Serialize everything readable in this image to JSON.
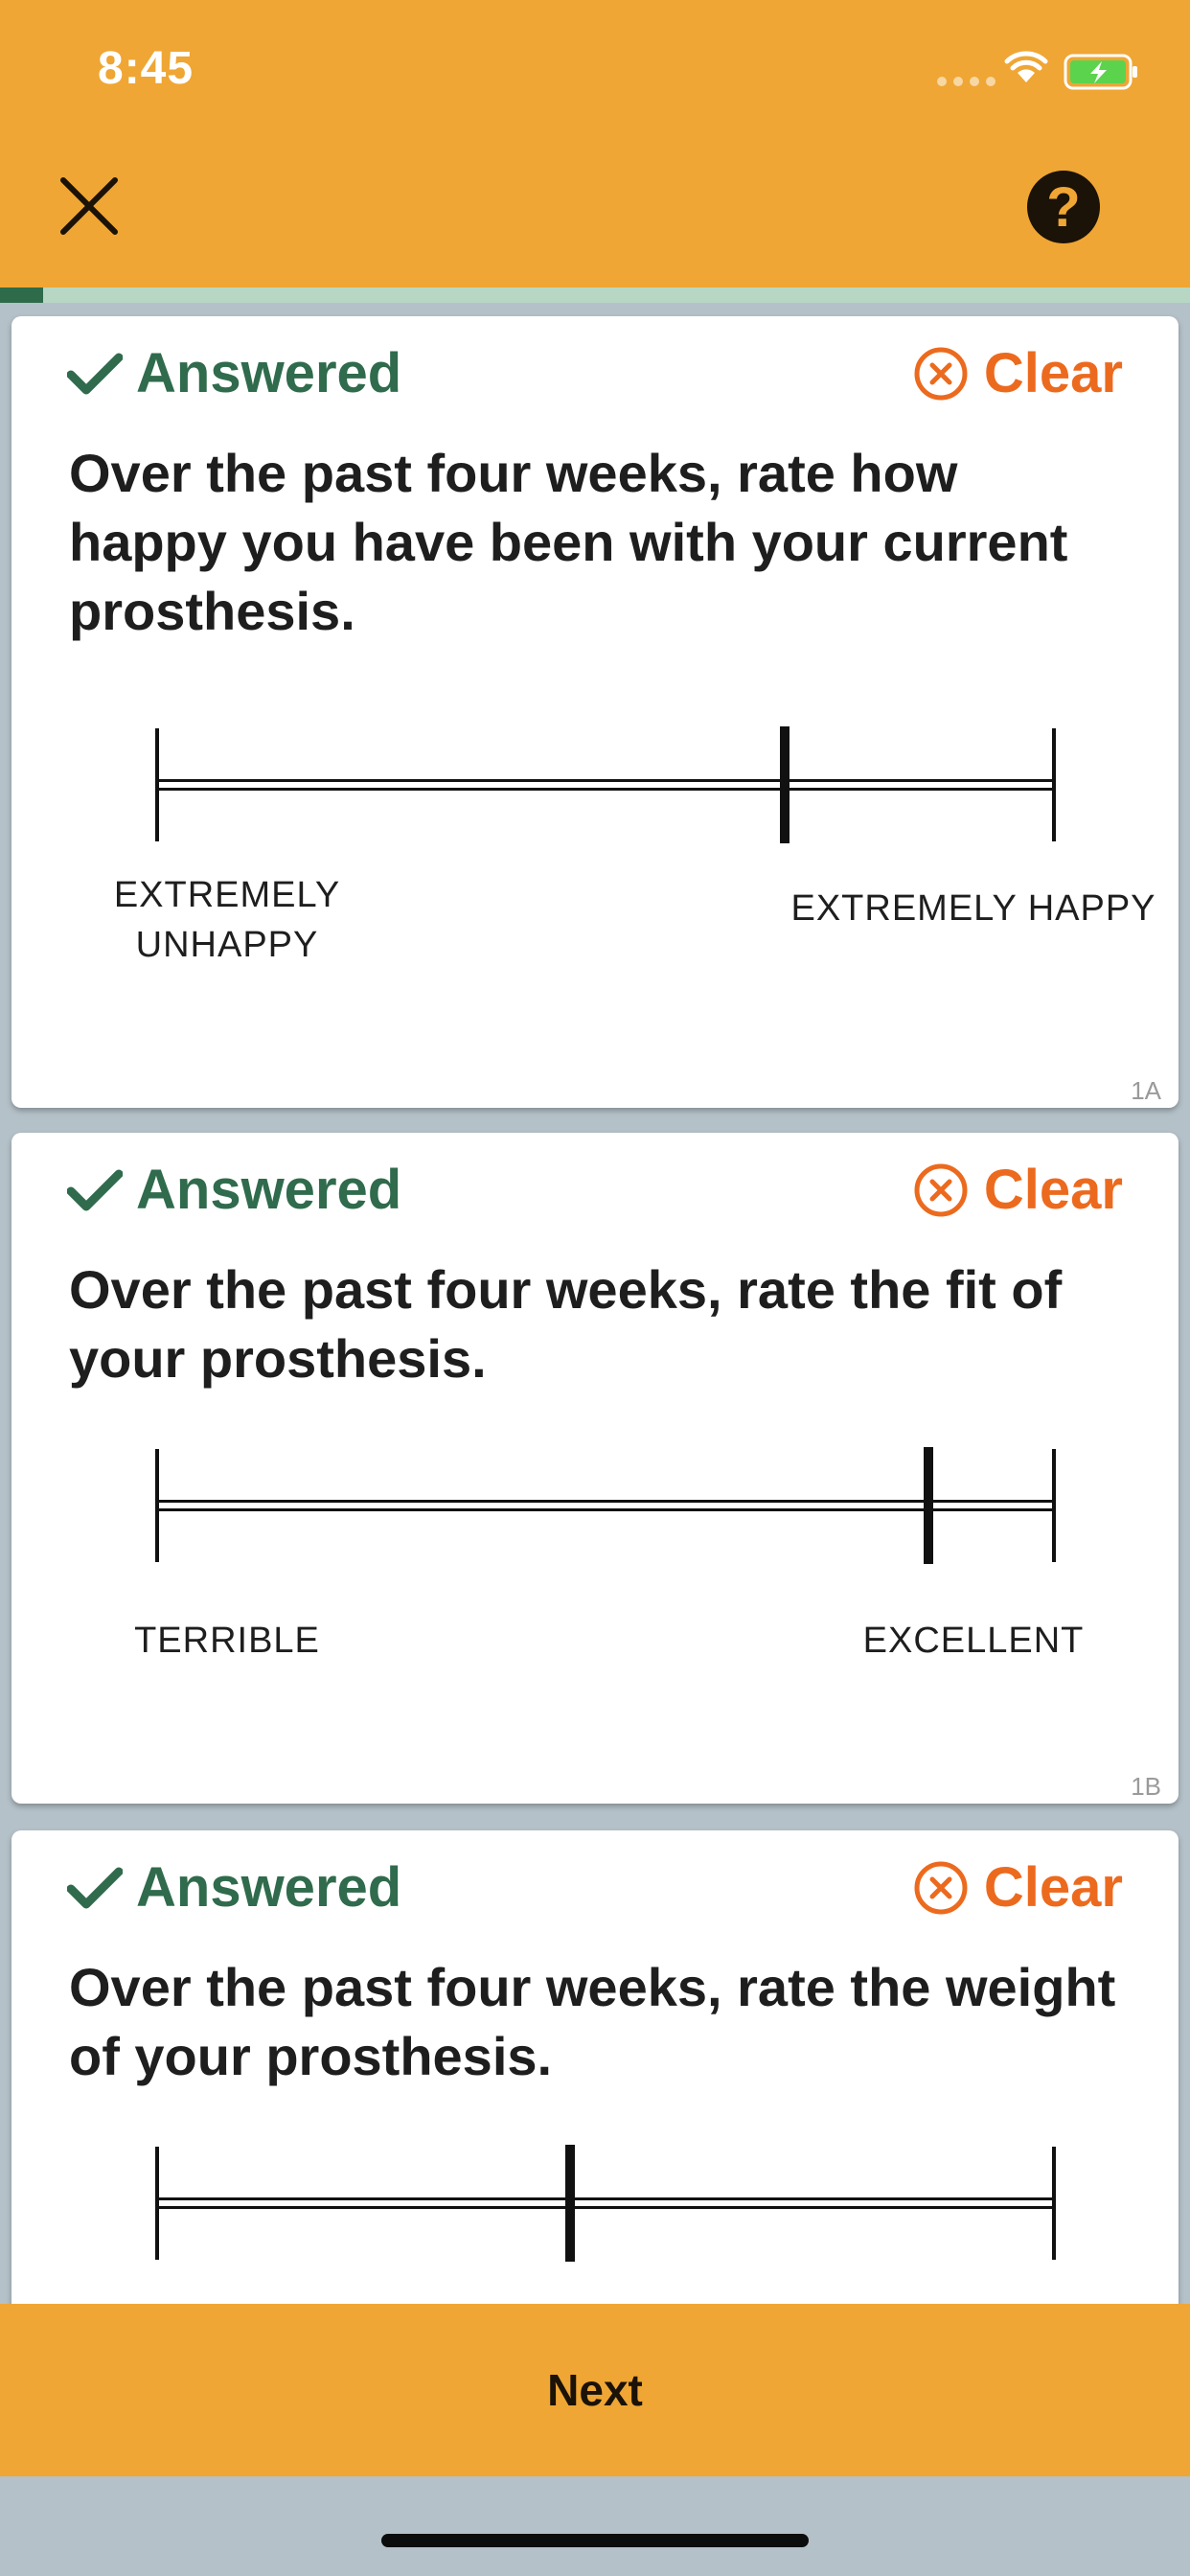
{
  "status_bar": {
    "time": "8:45"
  },
  "header": {
    "close_icon": "close-icon",
    "help_label": "?"
  },
  "progress": {
    "fraction": 0.036,
    "fill_color": "#2e6b4a",
    "track_color": "#b7d7c4"
  },
  "colors": {
    "accent": "#efa634",
    "answered": "#2f6b4c",
    "clear": "#ec6a1e"
  },
  "questions": [
    {
      "id": "1A",
      "status": "Answered",
      "clear_label": "Clear",
      "text": "Over the past four weeks, rate how happy you have been with your current prosthesis.",
      "left_label": "EXTREMELY\nUNHAPPY",
      "right_label": "EXTREMELY HAPPY",
      "value": 0.7
    },
    {
      "id": "1B",
      "status": "Answered",
      "clear_label": "Clear",
      "text": "Over the past four weeks, rate the fit of your prosthesis.",
      "left_label": "TERRIBLE",
      "right_label": "EXCELLENT",
      "value": 0.86
    },
    {
      "id": "",
      "status": "Answered",
      "clear_label": "Clear",
      "text": "Over the past four weeks, rate the weight of your prosthesis.",
      "value": 0.46
    }
  ],
  "footer": {
    "next_label": "Next"
  }
}
